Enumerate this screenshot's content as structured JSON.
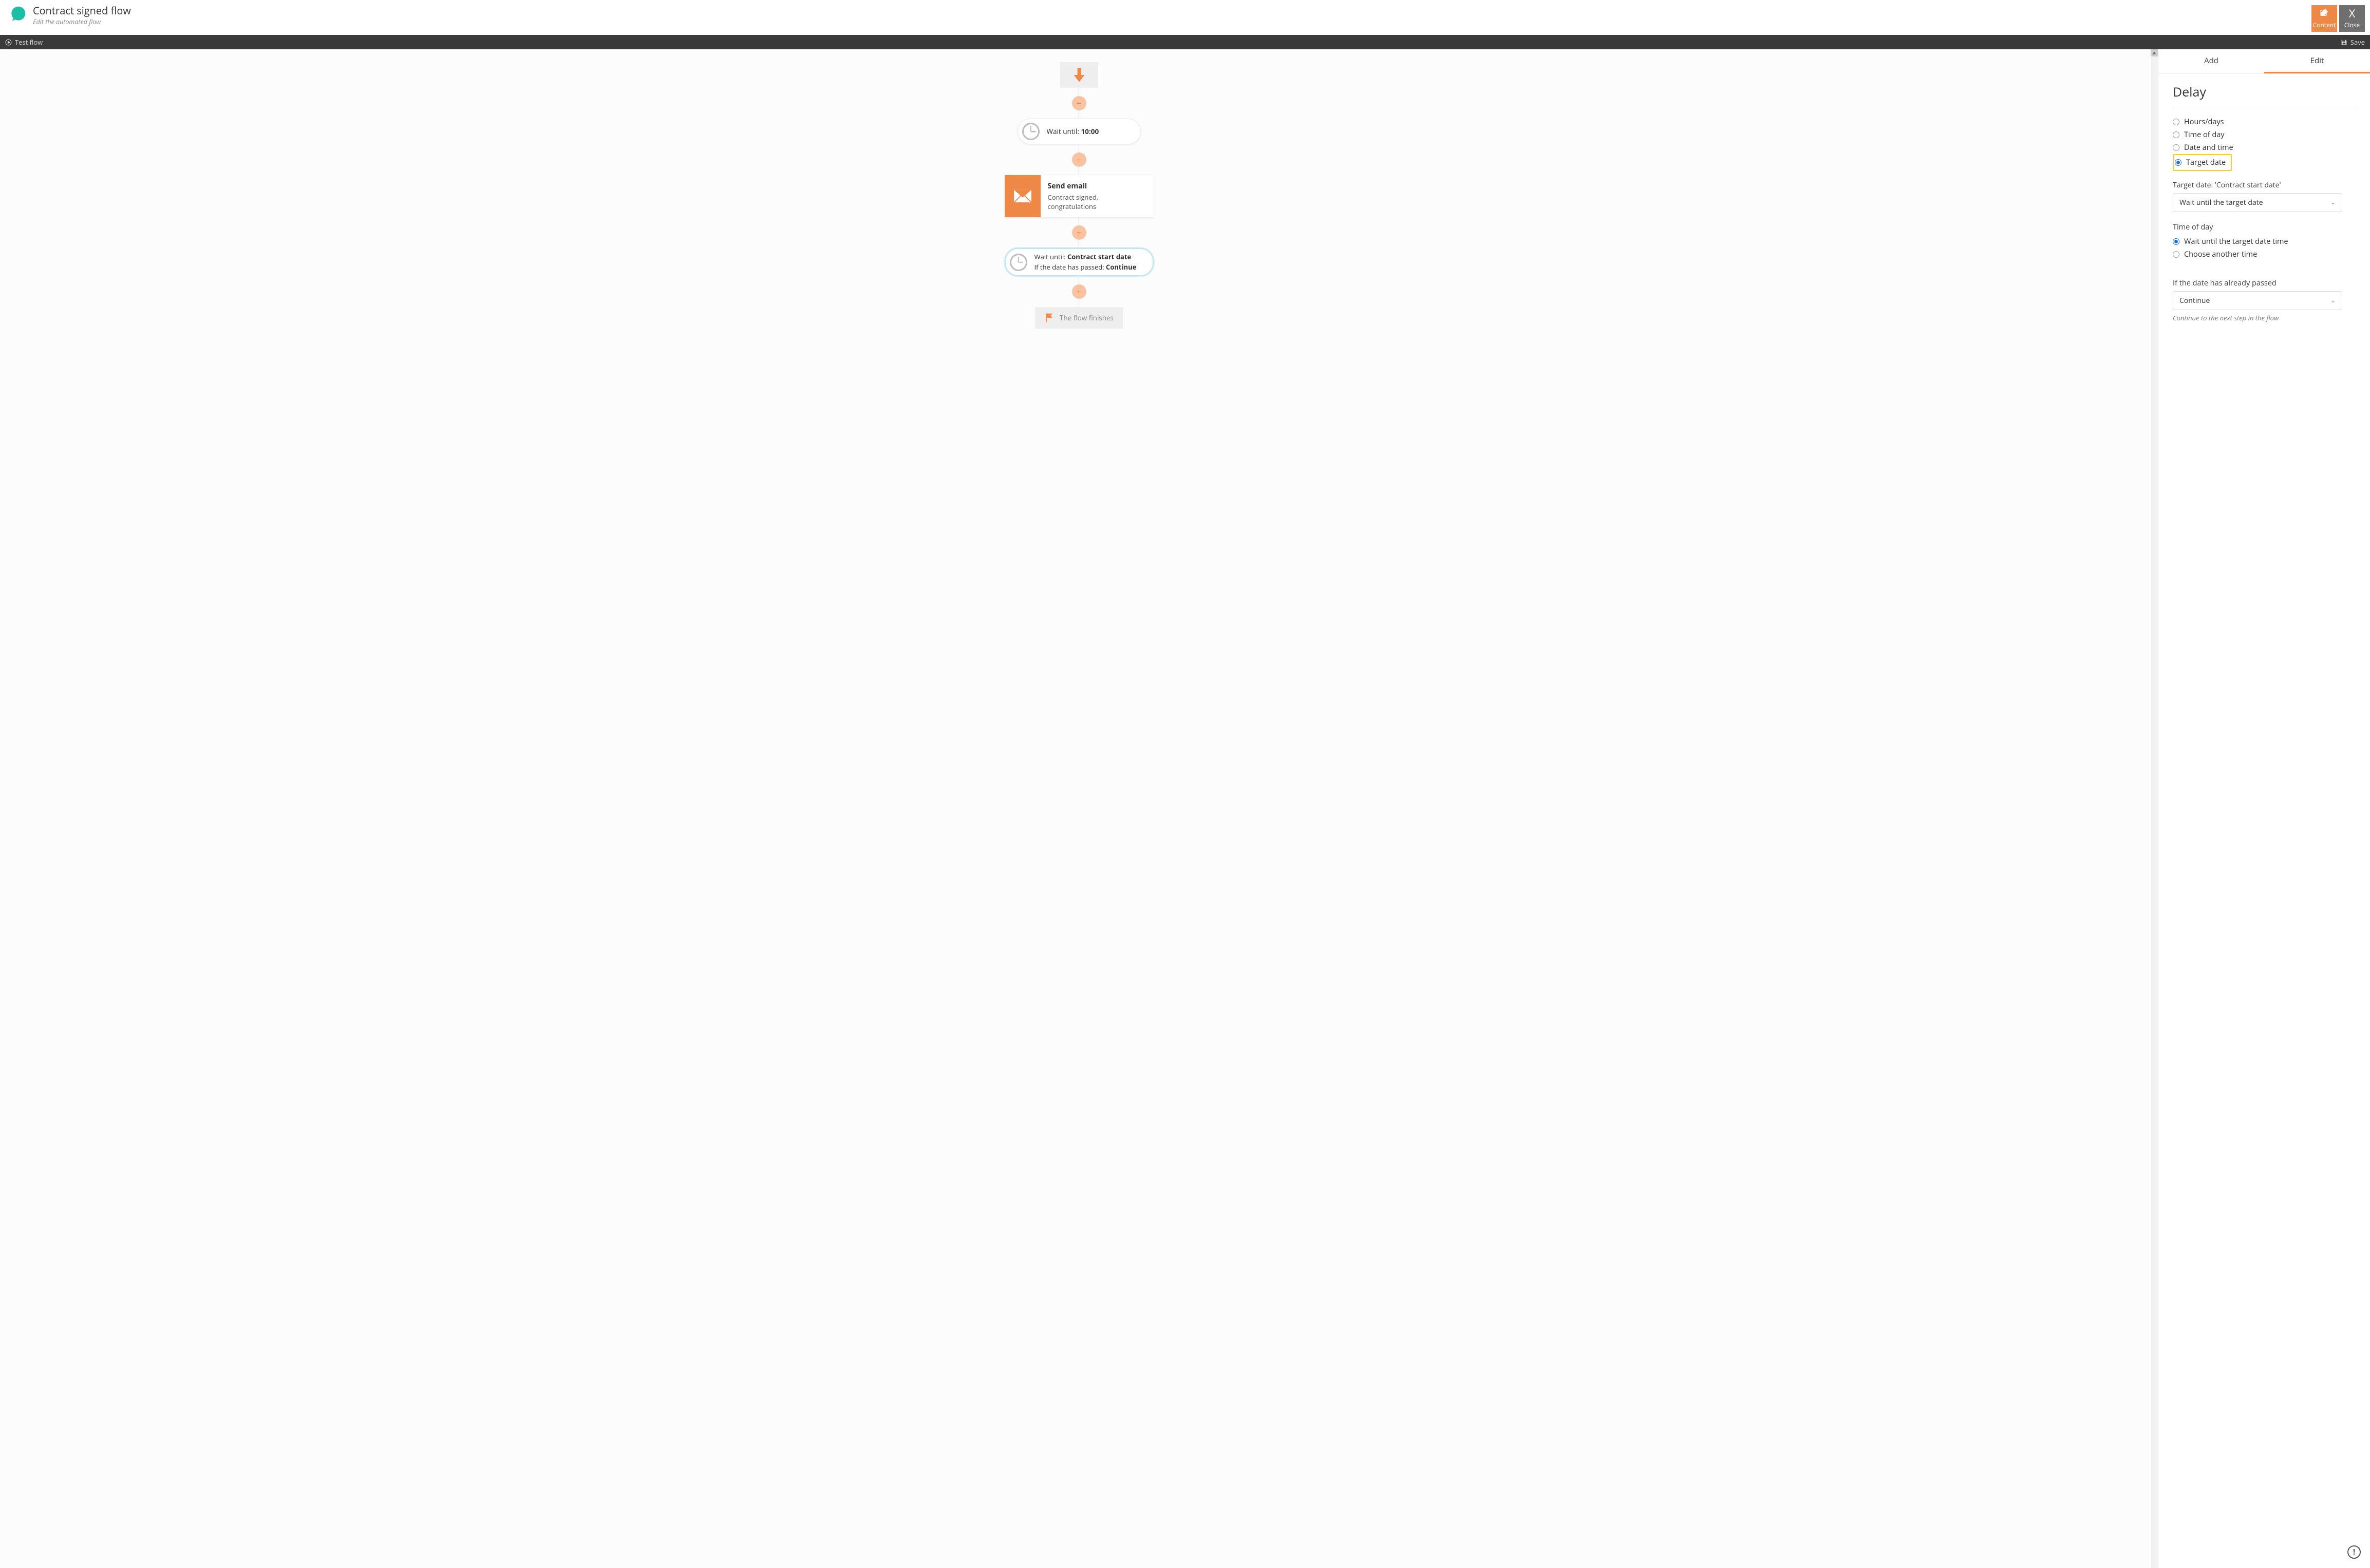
{
  "header": {
    "title": "Contract signed flow",
    "subtitle": "Edit the automated flow",
    "content_btn": "Content",
    "close_btn": "Close"
  },
  "darkbar": {
    "test": "Test flow",
    "save": "Save"
  },
  "flow": {
    "card1_prefix": "Wait until: ",
    "card1_value": "10:00",
    "email_title": "Send email",
    "email_subtitle": "Contract signed, congratulations",
    "card2_l1_prefix": "Wait until: ",
    "card2_l1_value": "Contract start date",
    "card2_l2_prefix": "If the date has passed: ",
    "card2_l2_value": "Continue",
    "end": "The flow finishes"
  },
  "panel": {
    "tab_add": "Add",
    "tab_edit": "Edit",
    "title": "Delay",
    "radios": {
      "hours_days": "Hours/days",
      "time_of_day": "Time of day",
      "date_time": "Date and time",
      "target_date": "Target date"
    },
    "target_label": "Target date: 'Contract start date'",
    "target_select": "Wait until the target date",
    "tod_label": "Time of day",
    "tod_opt1": "Wait until the target date time",
    "tod_opt2": "Choose another time",
    "passed_label": "If the date has already passed",
    "passed_select": "Continue",
    "passed_help": "Continue to the next step in the flow"
  }
}
